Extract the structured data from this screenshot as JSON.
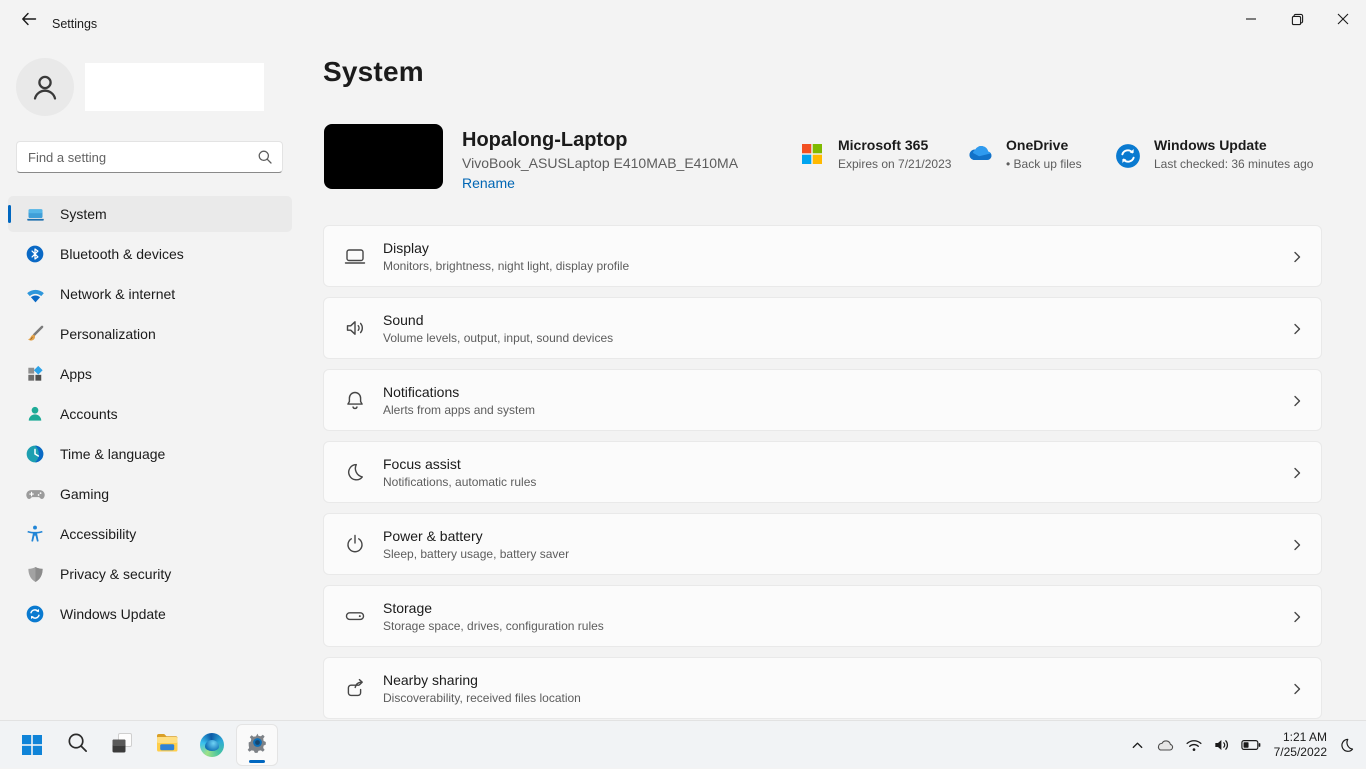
{
  "window": {
    "title": "Settings"
  },
  "sidebar": {
    "search_placeholder": "Find a setting",
    "items": [
      {
        "label": "System",
        "selected": true
      },
      {
        "label": "Bluetooth & devices",
        "selected": false
      },
      {
        "label": "Network & internet",
        "selected": false
      },
      {
        "label": "Personalization",
        "selected": false
      },
      {
        "label": "Apps",
        "selected": false
      },
      {
        "label": "Accounts",
        "selected": false
      },
      {
        "label": "Time & language",
        "selected": false
      },
      {
        "label": "Gaming",
        "selected": false
      },
      {
        "label": "Accessibility",
        "selected": false
      },
      {
        "label": "Privacy & security",
        "selected": false
      },
      {
        "label": "Windows Update",
        "selected": false
      }
    ]
  },
  "main": {
    "title": "System",
    "device": {
      "name": "Hopalong-Laptop",
      "model": "VivoBook_ASUSLaptop E410MAB_E410MA",
      "rename_label": "Rename"
    },
    "status_cards": [
      {
        "title": "Microsoft 365",
        "subtitle": "Expires on 7/21/2023"
      },
      {
        "title": "OneDrive",
        "subtitle": "• Back up files"
      },
      {
        "title": "Windows Update",
        "subtitle": "Last checked: 36 minutes ago"
      }
    ],
    "rows": [
      {
        "title": "Display",
        "subtitle": "Monitors, brightness, night light, display profile"
      },
      {
        "title": "Sound",
        "subtitle": "Volume levels, output, input, sound devices"
      },
      {
        "title": "Notifications",
        "subtitle": "Alerts from apps and system"
      },
      {
        "title": "Focus assist",
        "subtitle": "Notifications, automatic rules"
      },
      {
        "title": "Power & battery",
        "subtitle": "Sleep, battery usage, battery saver"
      },
      {
        "title": "Storage",
        "subtitle": "Storage space, drives, configuration rules"
      },
      {
        "title": "Nearby sharing",
        "subtitle": "Discoverability, received files location"
      }
    ]
  },
  "taskbar": {
    "apps": [
      "start",
      "search",
      "task-view",
      "file-explorer",
      "edge",
      "settings"
    ],
    "active_app": "settings",
    "tray": {
      "time": "1:21 AM",
      "date": "7/25/2022"
    }
  },
  "colors": {
    "accent": "#0067c0",
    "link": "#0066b4",
    "background": "#f3f3f3",
    "card": "#fbfbfb"
  }
}
